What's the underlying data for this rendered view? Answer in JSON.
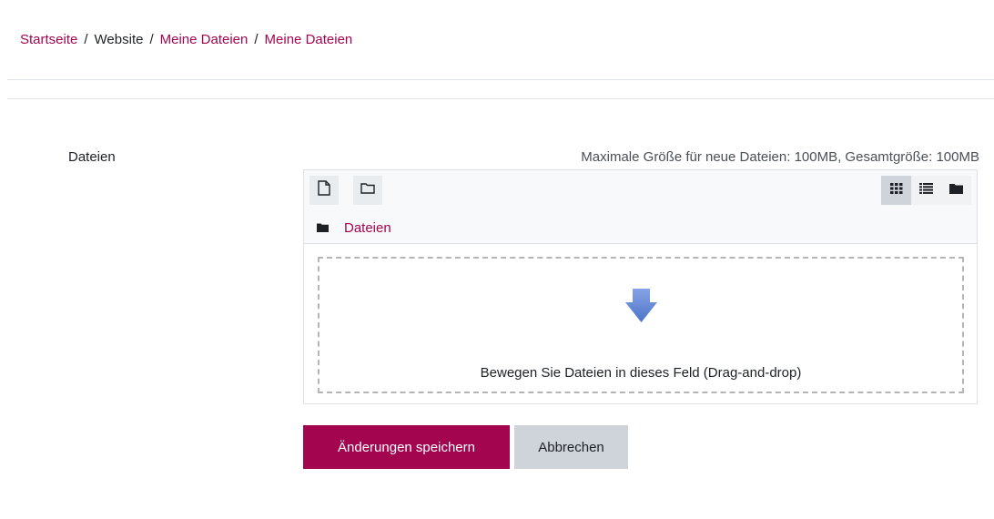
{
  "breadcrumb": {
    "items": [
      {
        "label": "Startseite",
        "link": true
      },
      {
        "label": "Website",
        "link": false
      },
      {
        "label": "Meine Dateien",
        "link": true
      },
      {
        "label": "Meine Dateien",
        "link": true
      }
    ],
    "separator": "/"
  },
  "form": {
    "field_label": "Dateien",
    "size_info": "Maximale Größe für neue Dateien: 100MB, Gesamtgröße: 100MB"
  },
  "filemanager": {
    "toolbar": {
      "add_icon": "file-add-icon",
      "mkdir_icon": "folder-create-icon",
      "views": [
        {
          "icon": "grid-view-icon",
          "active": true
        },
        {
          "icon": "list-view-icon",
          "active": false
        },
        {
          "icon": "tree-view-icon",
          "active": false
        }
      ]
    },
    "path_label": "Dateien",
    "dropzone_text": "Bewegen Sie Dateien in dieses Feld (Drag-and-drop)"
  },
  "buttons": {
    "save_label": "Änderungen speichern",
    "cancel_label": "Abbrechen"
  },
  "colors": {
    "brand": "#a3054f",
    "secondary_button": "#ced4da",
    "drop_arrow": "#6f8fd8"
  }
}
